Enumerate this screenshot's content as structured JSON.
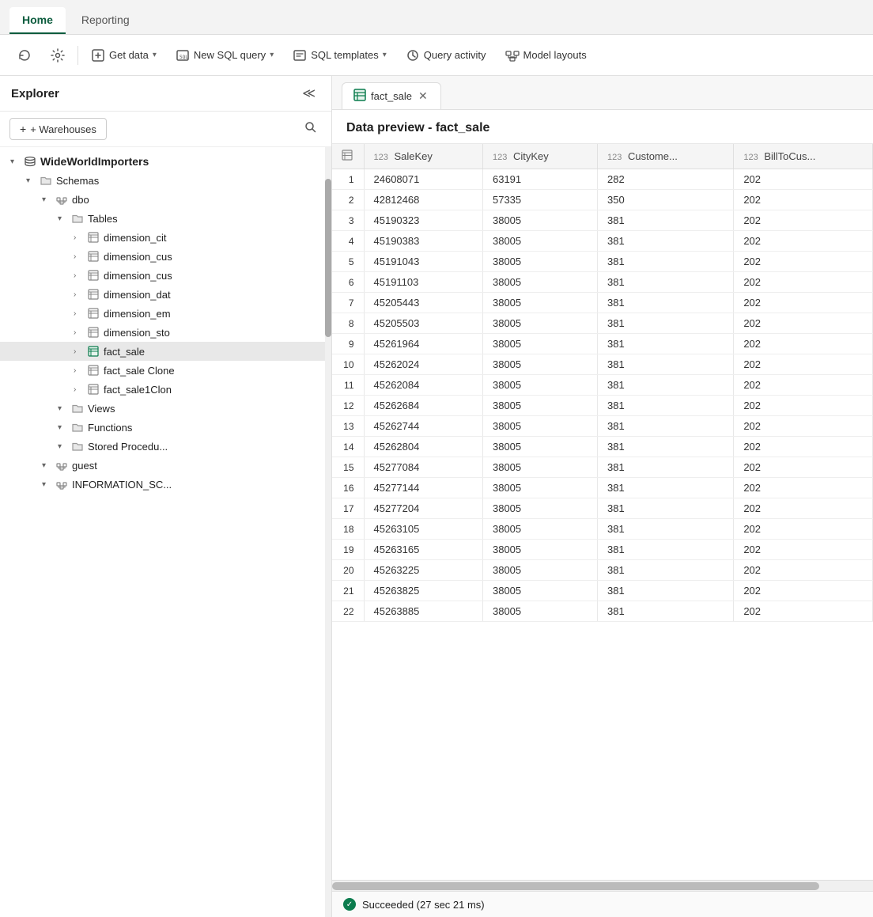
{
  "tabs": [
    {
      "label": "Home",
      "active": true
    },
    {
      "label": "Reporting",
      "active": false
    }
  ],
  "toolbar": {
    "buttons": [
      {
        "label": "",
        "icon": "refresh-icon",
        "type": "icon-only"
      },
      {
        "label": "",
        "icon": "settings-icon",
        "type": "icon-only"
      },
      {
        "label": "Get data",
        "icon": "get-data-icon",
        "hasChevron": true
      },
      {
        "label": "New SQL query",
        "icon": "sql-icon",
        "hasChevron": true
      },
      {
        "label": "SQL templates",
        "icon": "template-icon",
        "hasChevron": true
      },
      {
        "label": "Query activity",
        "icon": "query-icon",
        "hasChevron": false
      },
      {
        "label": "Model layouts",
        "icon": "model-icon",
        "hasChevron": false
      }
    ]
  },
  "sidebar": {
    "title": "Explorer",
    "add_warehouse_label": "+ Warehouses",
    "tree": [
      {
        "id": "wwi",
        "label": "WideWorldImporters",
        "level": 0,
        "type": "db",
        "expanded": true,
        "bold": true
      },
      {
        "id": "schemas",
        "label": "Schemas",
        "level": 1,
        "type": "folder",
        "expanded": true
      },
      {
        "id": "dbo",
        "label": "dbo",
        "level": 2,
        "type": "schema",
        "expanded": true
      },
      {
        "id": "tables",
        "label": "Tables",
        "level": 3,
        "type": "folder",
        "expanded": true
      },
      {
        "id": "dim_city",
        "label": "dimension_cit",
        "level": 4,
        "type": "table"
      },
      {
        "id": "dim_cus1",
        "label": "dimension_cus",
        "level": 4,
        "type": "table"
      },
      {
        "id": "dim_cus2",
        "label": "dimension_cus",
        "level": 4,
        "type": "table"
      },
      {
        "id": "dim_dat",
        "label": "dimension_dat",
        "level": 4,
        "type": "table"
      },
      {
        "id": "dim_em",
        "label": "dimension_em",
        "level": 4,
        "type": "table"
      },
      {
        "id": "dim_sto",
        "label": "dimension_sto",
        "level": 4,
        "type": "table"
      },
      {
        "id": "fact_sale",
        "label": "fact_sale",
        "level": 4,
        "type": "table-active",
        "selected": true
      },
      {
        "id": "fact_clone",
        "label": "fact_sale Clone",
        "level": 4,
        "type": "table"
      },
      {
        "id": "fact_1clon",
        "label": "fact_sale1Clon",
        "level": 4,
        "type": "table"
      },
      {
        "id": "views",
        "label": "Views",
        "level": 3,
        "type": "folder"
      },
      {
        "id": "functions",
        "label": "Functions",
        "level": 3,
        "type": "folder"
      },
      {
        "id": "stored_proc",
        "label": "Stored Procedu...",
        "level": 3,
        "type": "folder"
      },
      {
        "id": "guest",
        "label": "guest",
        "level": 2,
        "type": "schema"
      },
      {
        "id": "info_sc",
        "label": "INFORMATION_SC...",
        "level": 2,
        "type": "schema"
      }
    ]
  },
  "content_tab": {
    "label": "fact_sale",
    "icon": "table-icon"
  },
  "preview": {
    "title": "Data preview - fact_sale",
    "columns": [
      {
        "type": "123",
        "label": "SaleKey"
      },
      {
        "type": "123",
        "label": "CityKey"
      },
      {
        "type": "123",
        "label": "Custome..."
      },
      {
        "type": "123",
        "label": "BillToCus..."
      }
    ],
    "rows": [
      {
        "num": 1,
        "sale_key": "24608071",
        "city_key": "63191",
        "customer": "282",
        "bill_to": "202"
      },
      {
        "num": 2,
        "sale_key": "42812468",
        "city_key": "57335",
        "customer": "350",
        "bill_to": "202"
      },
      {
        "num": 3,
        "sale_key": "45190323",
        "city_key": "38005",
        "customer": "381",
        "bill_to": "202"
      },
      {
        "num": 4,
        "sale_key": "45190383",
        "city_key": "38005",
        "customer": "381",
        "bill_to": "202"
      },
      {
        "num": 5,
        "sale_key": "45191043",
        "city_key": "38005",
        "customer": "381",
        "bill_to": "202"
      },
      {
        "num": 6,
        "sale_key": "45191103",
        "city_key": "38005",
        "customer": "381",
        "bill_to": "202"
      },
      {
        "num": 7,
        "sale_key": "45205443",
        "city_key": "38005",
        "customer": "381",
        "bill_to": "202"
      },
      {
        "num": 8,
        "sale_key": "45205503",
        "city_key": "38005",
        "customer": "381",
        "bill_to": "202"
      },
      {
        "num": 9,
        "sale_key": "45261964",
        "city_key": "38005",
        "customer": "381",
        "bill_to": "202"
      },
      {
        "num": 10,
        "sale_key": "45262024",
        "city_key": "38005",
        "customer": "381",
        "bill_to": "202"
      },
      {
        "num": 11,
        "sale_key": "45262084",
        "city_key": "38005",
        "customer": "381",
        "bill_to": "202"
      },
      {
        "num": 12,
        "sale_key": "45262684",
        "city_key": "38005",
        "customer": "381",
        "bill_to": "202"
      },
      {
        "num": 13,
        "sale_key": "45262744",
        "city_key": "38005",
        "customer": "381",
        "bill_to": "202"
      },
      {
        "num": 14,
        "sale_key": "45262804",
        "city_key": "38005",
        "customer": "381",
        "bill_to": "202"
      },
      {
        "num": 15,
        "sale_key": "45277084",
        "city_key": "38005",
        "customer": "381",
        "bill_to": "202"
      },
      {
        "num": 16,
        "sale_key": "45277144",
        "city_key": "38005",
        "customer": "381",
        "bill_to": "202"
      },
      {
        "num": 17,
        "sale_key": "45277204",
        "city_key": "38005",
        "customer": "381",
        "bill_to": "202"
      },
      {
        "num": 18,
        "sale_key": "45263105",
        "city_key": "38005",
        "customer": "381",
        "bill_to": "202"
      },
      {
        "num": 19,
        "sale_key": "45263165",
        "city_key": "38005",
        "customer": "381",
        "bill_to": "202"
      },
      {
        "num": 20,
        "sale_key": "45263225",
        "city_key": "38005",
        "customer": "381",
        "bill_to": "202"
      },
      {
        "num": 21,
        "sale_key": "45263825",
        "city_key": "38005",
        "customer": "381",
        "bill_to": "202"
      },
      {
        "num": 22,
        "sale_key": "45263885",
        "city_key": "38005",
        "customer": "381",
        "bill_to": "202"
      }
    ]
  },
  "status": {
    "text": "Succeeded (27 sec 21 ms)"
  }
}
